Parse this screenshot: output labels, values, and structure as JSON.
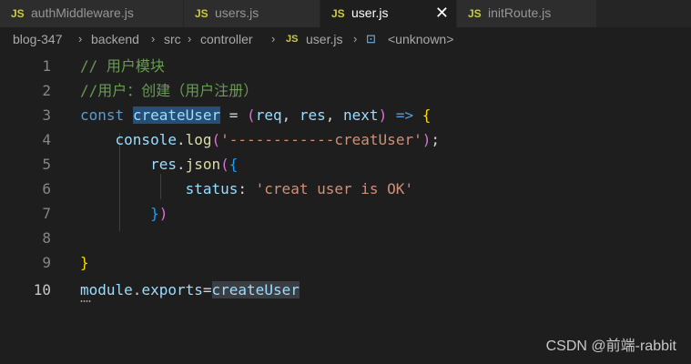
{
  "tabs": [
    {
      "icon": "JS",
      "label": "authMiddleware.js",
      "active": false
    },
    {
      "icon": "JS",
      "label": "users.js",
      "active": false
    },
    {
      "icon": "JS",
      "label": "user.js",
      "active": true,
      "close": "✕"
    },
    {
      "icon": "JS",
      "label": "initRoute.js",
      "active": false
    }
  ],
  "breadcrumb": {
    "items": [
      "blog-347",
      "backend",
      "src",
      "controller"
    ],
    "file_icon": "JS",
    "file": "user.js",
    "symbol_icon": "⊡",
    "symbol": "<unknown>",
    "separator": "›"
  },
  "editor": {
    "lines": [
      {
        "n": "1",
        "text": "// 用户模块"
      },
      {
        "n": "2",
        "text": "//用户：创建（用户注册）"
      },
      {
        "n": "3",
        "text": "const createUser = (req, res, next) => {"
      },
      {
        "n": "4",
        "text": "    console.log('------------creatUser');"
      },
      {
        "n": "5",
        "text": "        res.json({"
      },
      {
        "n": "6",
        "text": "            status: 'creat user is OK'"
      },
      {
        "n": "7",
        "text": "        })"
      },
      {
        "n": "8",
        "text": ""
      },
      {
        "n": "9",
        "text": "}"
      },
      {
        "n": "10",
        "text": "module.exports=createUser"
      }
    ],
    "current_line": "10"
  },
  "tokens": {
    "l1": "// 用户模块",
    "l2": "//用户：创建（用户注册）",
    "l3_const": "const",
    "l3_name": "createUser",
    "l3_eq": " = ",
    "l3_open": "(",
    "l3_req": "req",
    "l3_c1": ", ",
    "l3_res": "res",
    "l3_c2": ", ",
    "l3_next": "next",
    "l3_close": ")",
    "l3_arrow": " => ",
    "l3_brace": "{",
    "l4_console": "console",
    "l4_dot": ".",
    "l4_log": "log",
    "l4_open": "(",
    "l4_str": "'------------creatUser'",
    "l4_close": ")",
    "l4_semi": ";",
    "l5_res": "res",
    "l5_dot": ".",
    "l5_json": "json",
    "l5_open": "(",
    "l5_brace": "{",
    "l6_key": "status",
    "l6_colon": ": ",
    "l6_str": "'creat user is OK'",
    "l7_brace": "}",
    "l7_close": ")",
    "l9_brace": "}",
    "l10_module": "module",
    "l10_dot": ".",
    "l10_exports": "exports",
    "l10_eq": "=",
    "l10_name": "createUser"
  },
  "watermark": "CSDN @前端-rabbit",
  "colors": {
    "background": "#1e1e1e",
    "tabbar": "#252526",
    "comment": "#6a9955",
    "keyword": "#569cd6",
    "variable": "#9cdcfe",
    "function": "#dcdcaa",
    "string": "#ce9178",
    "bracket_gold": "#ffd700",
    "bracket_purple": "#da70d6",
    "bracket_blue": "#179fff",
    "js_icon": "#cbcb41"
  }
}
